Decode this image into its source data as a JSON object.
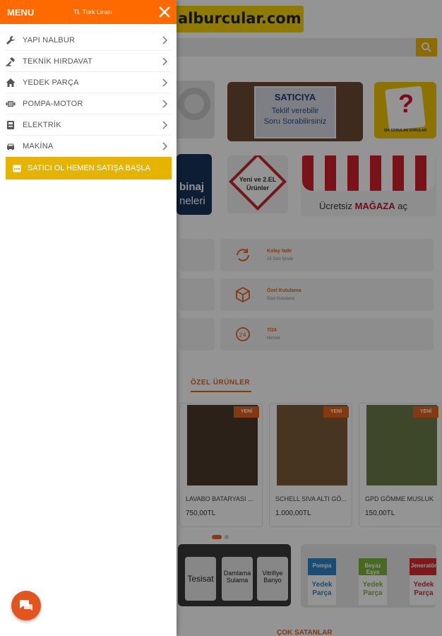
{
  "background": {
    "logo_text": "alburcular.com",
    "banners": {
      "satici_title": "SATICIYA",
      "satici_line1": "Teklif verebilir",
      "satici_line2": "Soru Sorabilirsiniz",
      "soru_caption": "SIK SORULAN SORULAR",
      "insaat_word1": "binaj",
      "insaat_word2": "neleri",
      "yeni_text": "Yeni ve 2.EL Ürünler",
      "magaza_text": "Ücretsiz",
      "magaza_bold": "MAĞAZA",
      "magaza_end": "aç"
    },
    "features": [
      {
        "title": "Kolay İade",
        "subtitle": "15 Gün İçinde"
      },
      {
        "title": "Özel Kutulama",
        "subtitle": "Özel Kutulama"
      },
      {
        "title": "7/24",
        "subtitle": "Hizmet"
      }
    ],
    "section_title": "ÖZEL ÜRÜNLER",
    "products": [
      {
        "badge": "YENİ",
        "name": "LAVABO BATARYASI ...",
        "price": "750,00TL"
      },
      {
        "badge": "YENİ",
        "name": "SCHELL SIVA ALTI GÖ...",
        "price": "1.000,00TL"
      },
      {
        "badge": "YENİ",
        "name": "GPD GÖMME MUSLUK",
        "price": "150,00TL"
      }
    ],
    "tags_banner": [
      "Tesisat",
      "Damlama Sulama",
      "Vitrifiye Banyo"
    ],
    "pompa_banner": [
      {
        "top": "Pompa",
        "bottom": "Yedek Parça",
        "color": "#2e86c8"
      },
      {
        "top": "Beyaz Eşya",
        "bottom": "Yedek Parça",
        "color": "#7cb63a"
      },
      {
        "top": "Jeneratör",
        "bottom": "Yedek Parça",
        "color": "#d92b2b"
      }
    ],
    "cok_satanlar": "ÇOK SATANLAR"
  },
  "drawer": {
    "title": "MENU",
    "currency": "TL Türk Lirası",
    "items": [
      {
        "label": "YAPI NALBUR",
        "icon": "wrench-icon"
      },
      {
        "label": "TEKNİK HIRDAVAT",
        "icon": "hammer-icon"
      },
      {
        "label": "YEDEK PARÇA",
        "icon": "house-icon"
      },
      {
        "label": "POMPA-MOTOR",
        "icon": "motor-icon"
      },
      {
        "label": "ELEKTRİK",
        "icon": "electric-icon"
      },
      {
        "label": "MAKİNA",
        "icon": "car-icon"
      }
    ],
    "seller_button": "SATICI OL HEMEN SATIŞA BAŞLA"
  },
  "colors": {
    "header_orange": "#ff6a00",
    "accent_orange": "#e2651c",
    "seller_yellow": "#e4b400",
    "chat_button": "#e2551e"
  }
}
